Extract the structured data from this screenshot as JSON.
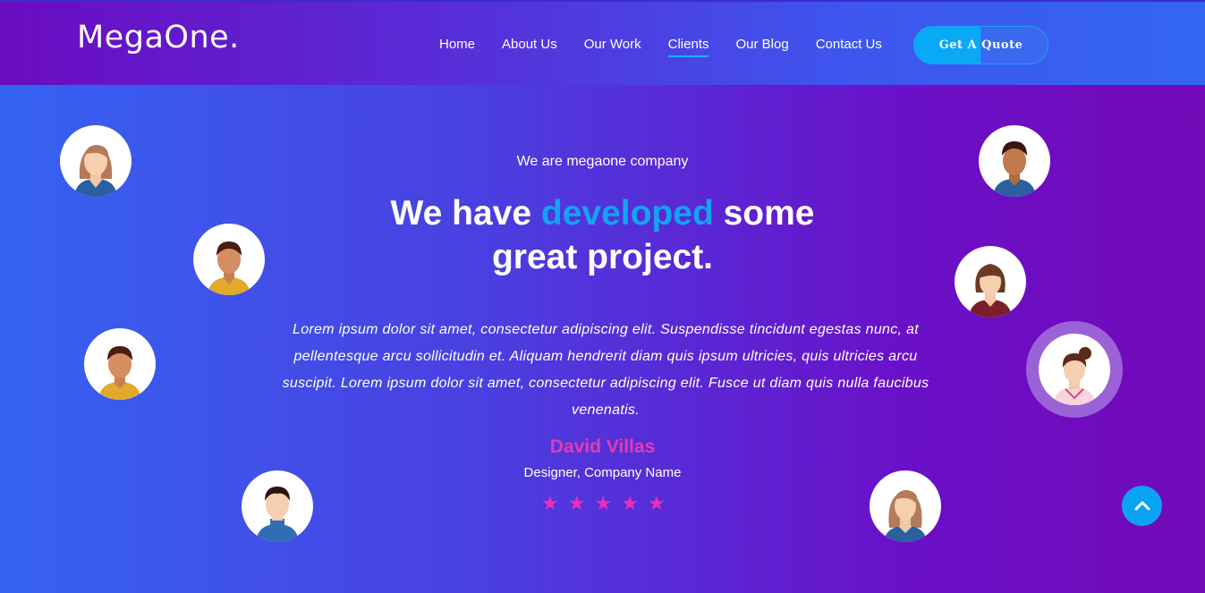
{
  "brand": {
    "logo": "MegaOne."
  },
  "nav": {
    "items": [
      {
        "label": "Home",
        "active": false
      },
      {
        "label": "About Us",
        "active": false
      },
      {
        "label": "Our Work",
        "active": false
      },
      {
        "label": "Clients",
        "active": true
      },
      {
        "label": "Our Blog",
        "active": false
      },
      {
        "label": "Contact Us",
        "active": false
      }
    ],
    "cta_label": "Get A Quote"
  },
  "hero": {
    "subtitle": "We are megaone company",
    "headline_part1": "We have ",
    "headline_highlight": "developed",
    "headline_part2": " some",
    "headline_line2": "great project."
  },
  "testimonial": {
    "quote": "Lorem ipsum dolor sit amet, consectetur adipiscing elit. Suspendisse tincidunt egestas nunc, at pellentesque arcu sollicitudin et. Aliquam hendrerit diam quis ipsum ultricies, quis ultricies arcu suscipit. Lorem ipsum dolor sit amet, consectetur adipiscing elit. Fusce ut diam quis nulla faucibus venenatis.",
    "author": "David Villas",
    "role": "Designer, Company Name",
    "rating": 5
  },
  "icons": {
    "star": "star-icon",
    "scroll_top": "chevron-up-icon",
    "avatar": "person-avatar"
  },
  "colors": {
    "accent_blue": "#13a3f0",
    "accent_pink": "#e23bb0",
    "nav_underline": "#13b6ff"
  }
}
